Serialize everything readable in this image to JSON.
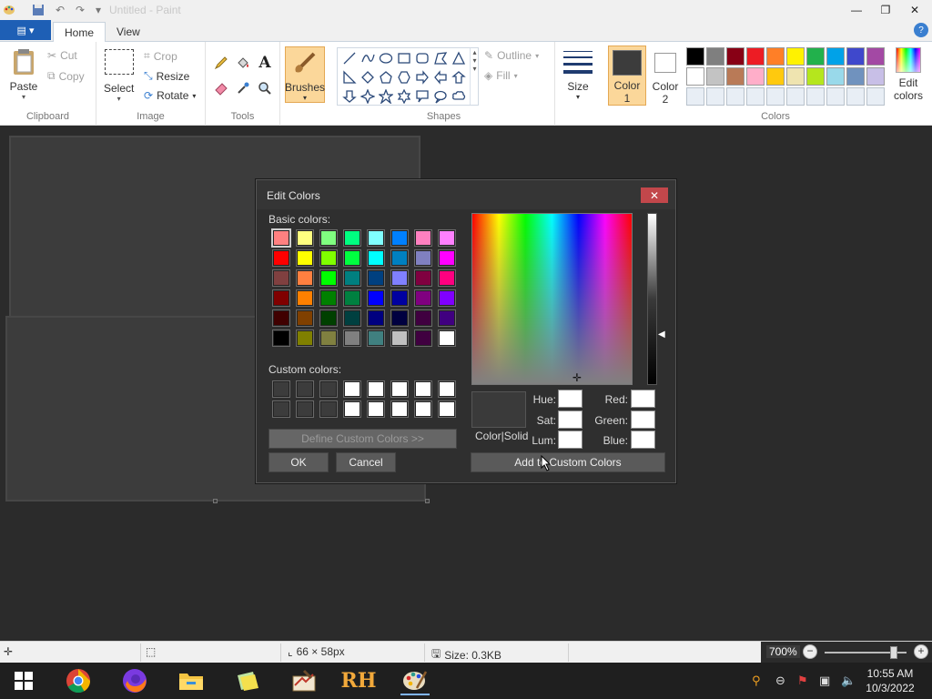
{
  "window": {
    "title": "Untitled - Paint",
    "minimize": "—",
    "restore": "❐",
    "close": "✕"
  },
  "tabs": {
    "file": "▤ ▾",
    "home": "Home",
    "view": "View",
    "help": "?"
  },
  "ribbon": {
    "clipboard": {
      "label": "Clipboard",
      "paste": "Paste",
      "cut": "Cut",
      "copy": "Copy"
    },
    "image": {
      "label": "Image",
      "select": "Select",
      "crop": "Crop",
      "resize": "Resize",
      "rotate": "Rotate"
    },
    "tools": {
      "label": "Tools"
    },
    "brushes": {
      "label": "Brushes"
    },
    "shapes": {
      "label": "Shapes",
      "outline": "Outline",
      "fill": "Fill"
    },
    "size": {
      "label": "Size"
    },
    "color1": {
      "label1": "Color",
      "label2": "1",
      "value": "#3c3c3c"
    },
    "color2": {
      "label1": "Color",
      "label2": "2",
      "value": "#ffffff"
    },
    "colors": {
      "label": "Colors",
      "edit_label1": "Edit",
      "edit_label2": "colors",
      "row1": [
        "#000000",
        "#7f7f7f",
        "#880015",
        "#ed1c24",
        "#ff7f27",
        "#fff200",
        "#22b14c",
        "#00a2e8",
        "#3f48cc",
        "#a349a4"
      ],
      "row2": [
        "#ffffff",
        "#c3c3c3",
        "#b97a57",
        "#ffaec9",
        "#ffc90e",
        "#efe4b0",
        "#b5e61d",
        "#99d9ea",
        "#7092be",
        "#c8bfe7"
      ]
    }
  },
  "status": {
    "dimensions": "66 × 58px",
    "size": "Size: 0.3KB",
    "zoom": "700%"
  },
  "taskbar": {
    "time": "10:55 AM",
    "date": "10/3/2022"
  },
  "dialog": {
    "title": "Edit Colors",
    "basic_label": "Basic colors:",
    "custom_label": "Custom colors:",
    "define_btn": "Define Custom Colors >>",
    "ok": "OK",
    "cancel": "Cancel",
    "color_solid": "Color|Solid",
    "hue": "Hue:",
    "sat": "Sat:",
    "lum": "Lum:",
    "red": "Red:",
    "green": "Green:",
    "blue": "Blue:",
    "add_btn": "Add to Custom Colors",
    "basic_colors": [
      [
        "#ff8080",
        "#ffff80",
        "#80ff80",
        "#00ff80",
        "#80ffff",
        "#0080ff",
        "#ff80c0",
        "#ff80ff"
      ],
      [
        "#ff0000",
        "#ffff00",
        "#80ff00",
        "#00ff40",
        "#00ffff",
        "#0080c0",
        "#8080c0",
        "#ff00ff"
      ],
      [
        "#804040",
        "#ff8040",
        "#00ff00",
        "#008080",
        "#004080",
        "#8080ff",
        "#800040",
        "#ff0080"
      ],
      [
        "#800000",
        "#ff8000",
        "#008000",
        "#008040",
        "#0000ff",
        "#0000a0",
        "#800080",
        "#8000ff"
      ],
      [
        "#400000",
        "#804000",
        "#004000",
        "#004040",
        "#000080",
        "#000040",
        "#400040",
        "#400080"
      ],
      [
        "#000000",
        "#808000",
        "#808040",
        "#808080",
        "#408080",
        "#c0c0c0",
        "#400040",
        "#ffffff"
      ]
    ],
    "custom_colors": [
      [
        "#3c3c3c",
        "#3c3c3c",
        "#3c3c3c",
        "#ffffff",
        "#ffffff",
        "#ffffff",
        "#ffffff",
        "#ffffff"
      ],
      [
        "#3c3c3c",
        "#3c3c3c",
        "#3c3c3c",
        "#ffffff",
        "#ffffff",
        "#ffffff",
        "#ffffff",
        "#ffffff"
      ]
    ]
  }
}
